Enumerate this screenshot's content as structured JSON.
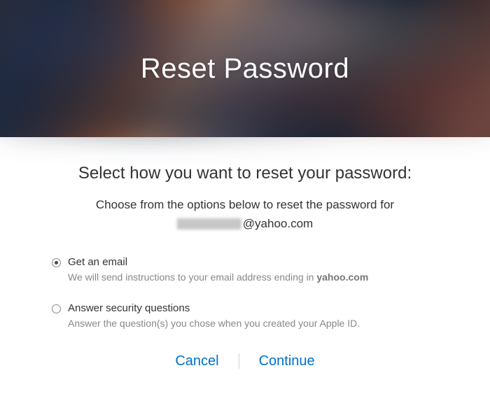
{
  "hero": {
    "title": "Reset Password"
  },
  "subheading": "Select how you want to reset your password:",
  "description": "Choose from the options below to reset the password for",
  "email_suffix": "@yahoo.com",
  "options": [
    {
      "title": "Get an email",
      "desc_prefix": "We will send instructions to your email address ending in ",
      "desc_bold": "yahoo.com",
      "selected": true
    },
    {
      "title": "Answer security questions",
      "desc_prefix": "Answer the question(s) you chose when you created your Apple ID.",
      "desc_bold": "",
      "selected": false
    }
  ],
  "actions": {
    "cancel": "Cancel",
    "continue": "Continue"
  }
}
